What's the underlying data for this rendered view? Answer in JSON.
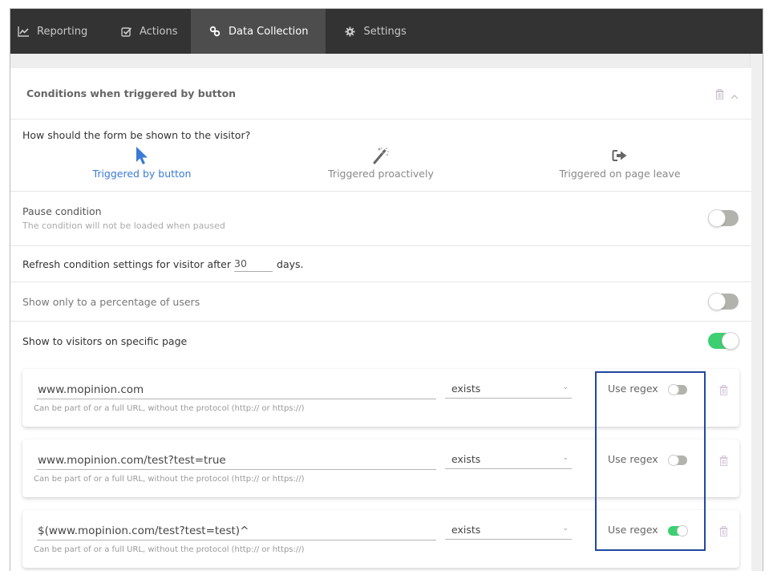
{
  "nav": {
    "tabs": [
      {
        "label": "Reporting",
        "icon": "chart-line-icon",
        "active": false
      },
      {
        "label": "Actions",
        "icon": "checkbox-icon",
        "active": false
      },
      {
        "label": "Data Collection",
        "icon": "link-icon",
        "active": true
      },
      {
        "label": "Settings",
        "icon": "gear-icon",
        "active": false
      }
    ]
  },
  "section": {
    "title": "Conditions when triggered by button",
    "actions": [
      "trash-icon",
      "chevron-up-icon"
    ]
  },
  "trigger": {
    "question": "How should the form be shown to the visitor?",
    "options": [
      {
        "label": "Triggered by button",
        "icon": "cursor-arrow-icon",
        "active": true
      },
      {
        "label": "Triggered proactively",
        "icon": "magic-wand-icon",
        "active": false
      },
      {
        "label": "Triggered on page leave",
        "icon": "sign-out-icon",
        "active": false
      }
    ]
  },
  "pause": {
    "label": "Pause condition",
    "description": "The condition will not be loaded when paused",
    "enabled": false
  },
  "refresh": {
    "prefix": "Refresh condition settings for visitor after",
    "value": "30",
    "suffix": "days."
  },
  "percentage": {
    "label": "Show only to a percentage of users",
    "enabled": false
  },
  "specific_page": {
    "label": "Show to visitors on specific page",
    "enabled": true,
    "rules": [
      {
        "url": "www.mopinion.com",
        "hint": "Can be part of or a full URL, without the protocol (http:// or https://)",
        "operator": "exists",
        "regex_label": "Use regex",
        "use_regex": false
      },
      {
        "url": "www.mopinion.com/test?test=true",
        "hint": "Can be part of or a full URL, without the protocol (http:// or https://)",
        "operator": "exists",
        "regex_label": "Use regex",
        "use_regex": false
      },
      {
        "url": "$(www.mopinion.com/test?test=test)^",
        "hint": "Can be part of or a full URL, without the protocol (http:// or https://)",
        "operator": "exists",
        "regex_label": "Use regex",
        "use_regex": true
      }
    ]
  },
  "colors": {
    "nav_bg": "#333333",
    "nav_active_bg": "#4d4d4d",
    "accent_blue": "#3a7bd5",
    "toggle_on": "#3ecf72",
    "toggle_off": "#b3b3ae",
    "highlight_box": "#2148a1"
  }
}
